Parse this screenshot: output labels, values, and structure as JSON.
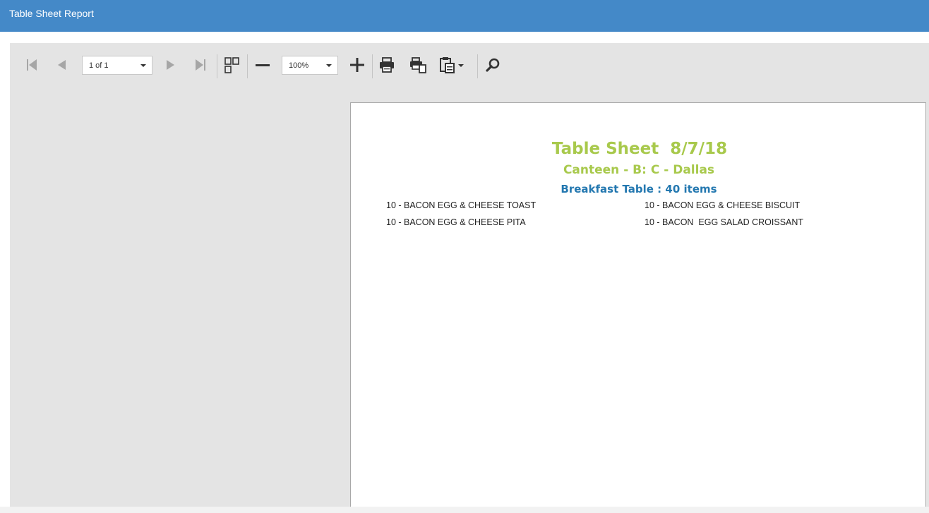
{
  "app": {
    "title": "Table Sheet Report"
  },
  "toolbar": {
    "page_selector": "1 of 1",
    "zoom_selector": "100%"
  },
  "report": {
    "title": "Table Sheet  8/7/18",
    "subtitle": "Canteen - B: C - Dallas",
    "section": "Breakfast Table : 40 items",
    "items": [
      "10 - BACON EGG & CHEESE TOAST",
      "10 - BACON EGG & CHEESE BISCUIT",
      "10 - BACON EGG & CHEESE PITA",
      "10 - BACON  EGG SALAD CROISSANT"
    ]
  },
  "colors": {
    "header_bar": "#4489c8",
    "title_green": "#a8c94c",
    "section_blue": "#2478b0",
    "icon_enabled": "#333333",
    "icon_disabled": "#a6a6a6"
  }
}
